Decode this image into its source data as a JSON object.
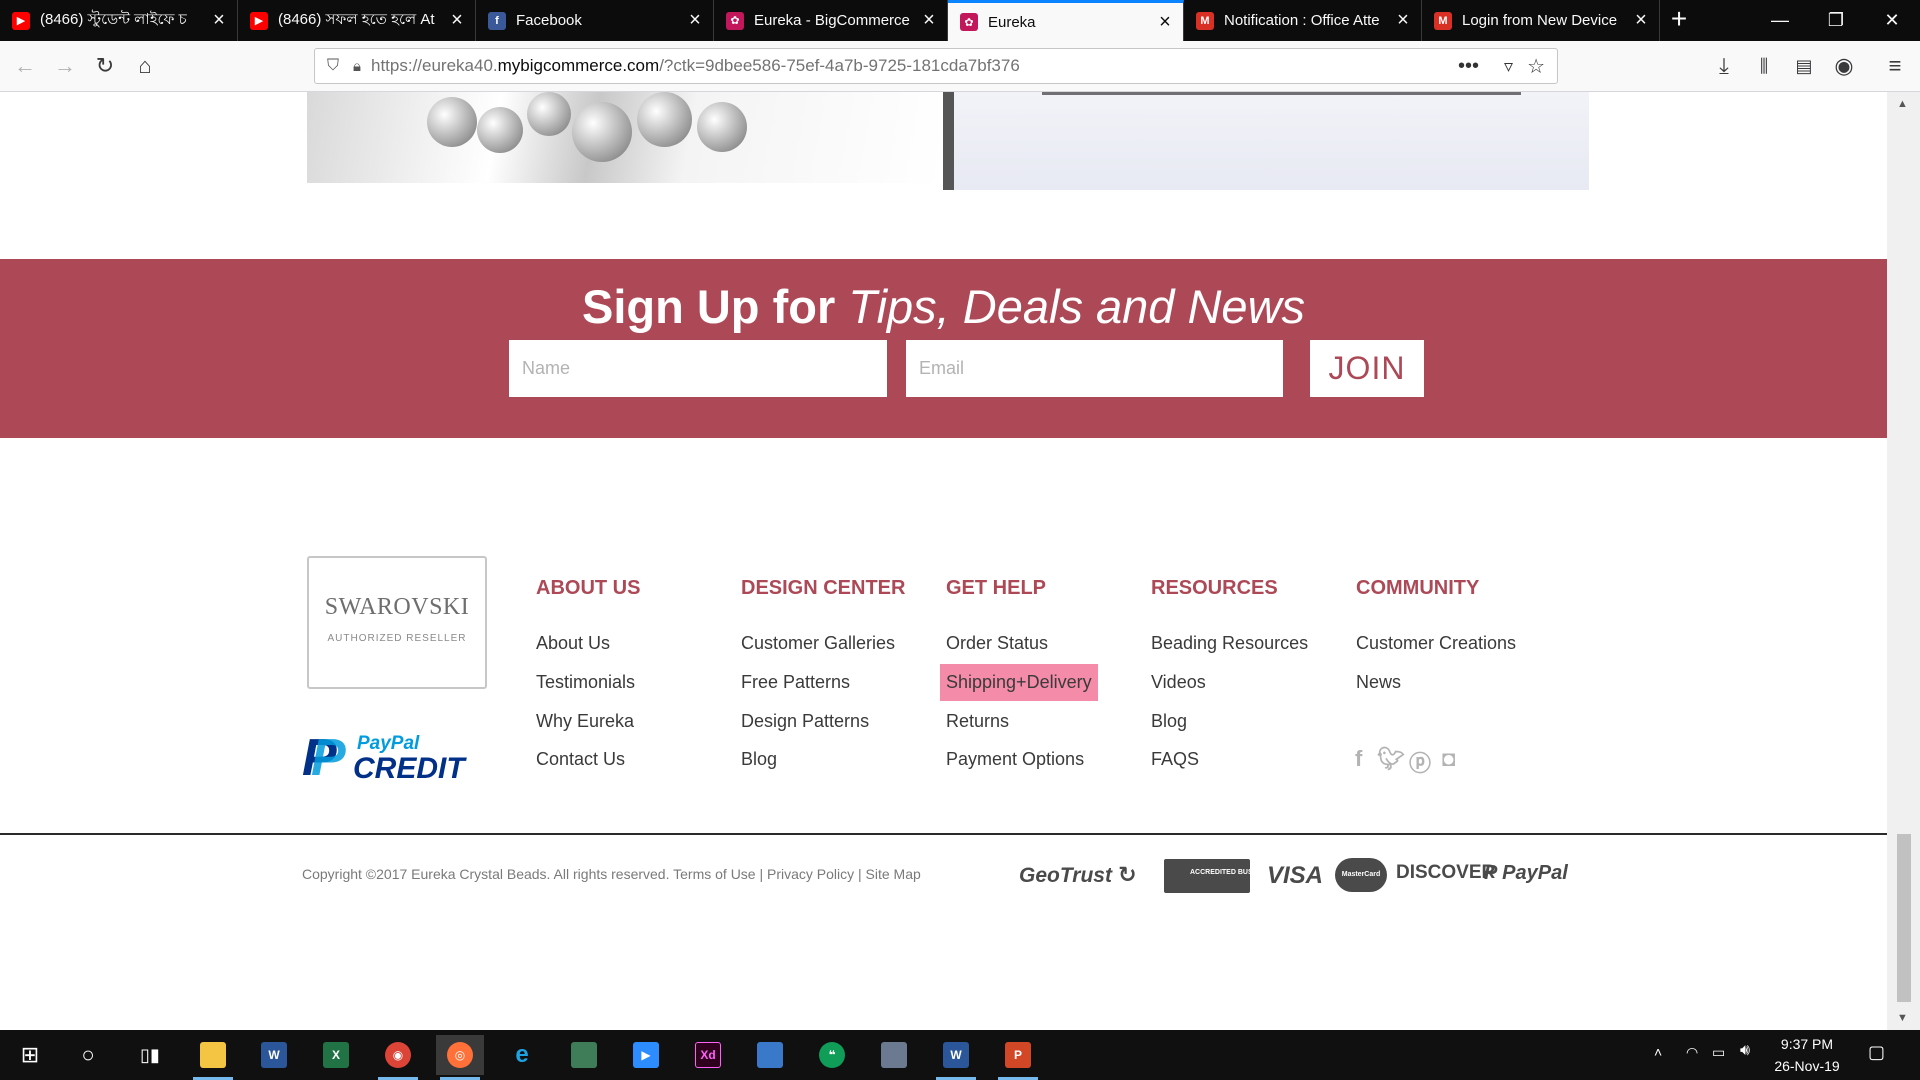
{
  "browser": {
    "tabs": [
      {
        "label": "(8466) স্টুডেন্ট লাইফে চ",
        "favicon": "youtube-icon",
        "color": "#ff0000"
      },
      {
        "label": "(8466) সফল হতে হলে At",
        "favicon": "youtube-icon",
        "color": "#ff0000"
      },
      {
        "label": "Facebook",
        "favicon": "facebook-icon",
        "color": "#3b5998"
      },
      {
        "label": "Eureka - BigCommerce",
        "favicon": "eureka-icon",
        "color": "#c2185b"
      },
      {
        "label": "Eureka",
        "favicon": "eureka-icon",
        "color": "#c2185b"
      },
      {
        "label": "Notification : Office Atte",
        "favicon": "gmail-icon",
        "color": "#d93025"
      },
      {
        "label": "Login from New Device",
        "favicon": "gmail-icon",
        "color": "#d93025"
      }
    ],
    "url": {
      "prefix": "https://eureka40.",
      "domain": "mybigcommerce.com",
      "suffix": "/?ctk=9dbee586-75ef-4a7b-9725-181cda7bf376"
    }
  },
  "signup": {
    "title_bold": "Sign Up for",
    "title_italic": "Tips, Deals and News",
    "name_placeholder": "Name",
    "email_placeholder": "Email",
    "join_label": "JOIN"
  },
  "footer": {
    "swarovski": {
      "name": "SWAROVSKI",
      "tagline": "AUTHORIZED RESELLER"
    },
    "paypal_credit": {
      "paypal": "PayPal",
      "credit": "CREDIT"
    },
    "columns": [
      {
        "heading": "ABOUT US",
        "links": [
          "About Us",
          "Testimonials",
          "Why Eureka",
          "Contact Us"
        ]
      },
      {
        "heading": "DESIGN CENTER",
        "links": [
          "Customer Galleries",
          "Free Patterns",
          "Design Patterns",
          "Blog"
        ]
      },
      {
        "heading": "GET HELP",
        "links": [
          "Order Status",
          "Shipping+Delivery",
          "Returns",
          "Payment Options"
        ]
      },
      {
        "heading": "RESOURCES",
        "links": [
          "Beading Resources",
          "Videos",
          "Blog",
          "FAQS"
        ]
      },
      {
        "heading": "COMMUNITY",
        "links": [
          "Customer Creations",
          "News"
        ]
      }
    ],
    "social_icons": [
      "facebook-icon",
      "twitter-icon",
      "pinterest-icon",
      "instagram-icon"
    ],
    "copyright": "Copyright ©2017 Eureka Crystal Beads. All rights reserved. Terms of Use | Privacy Policy | Site Map",
    "payment_logos": {
      "geotrust": "GeoTrust",
      "bbb": "ACCREDITED BUSINESS",
      "visa": "VISA",
      "mastercard": "MasterCard",
      "discover": "DISCOVER",
      "paypal": "PayPal"
    },
    "highlight_color": "#f48ba8",
    "accent_color": "#ad4956"
  },
  "taskbar": {
    "time": "9:37 PM",
    "date": "26-Nov-19"
  }
}
